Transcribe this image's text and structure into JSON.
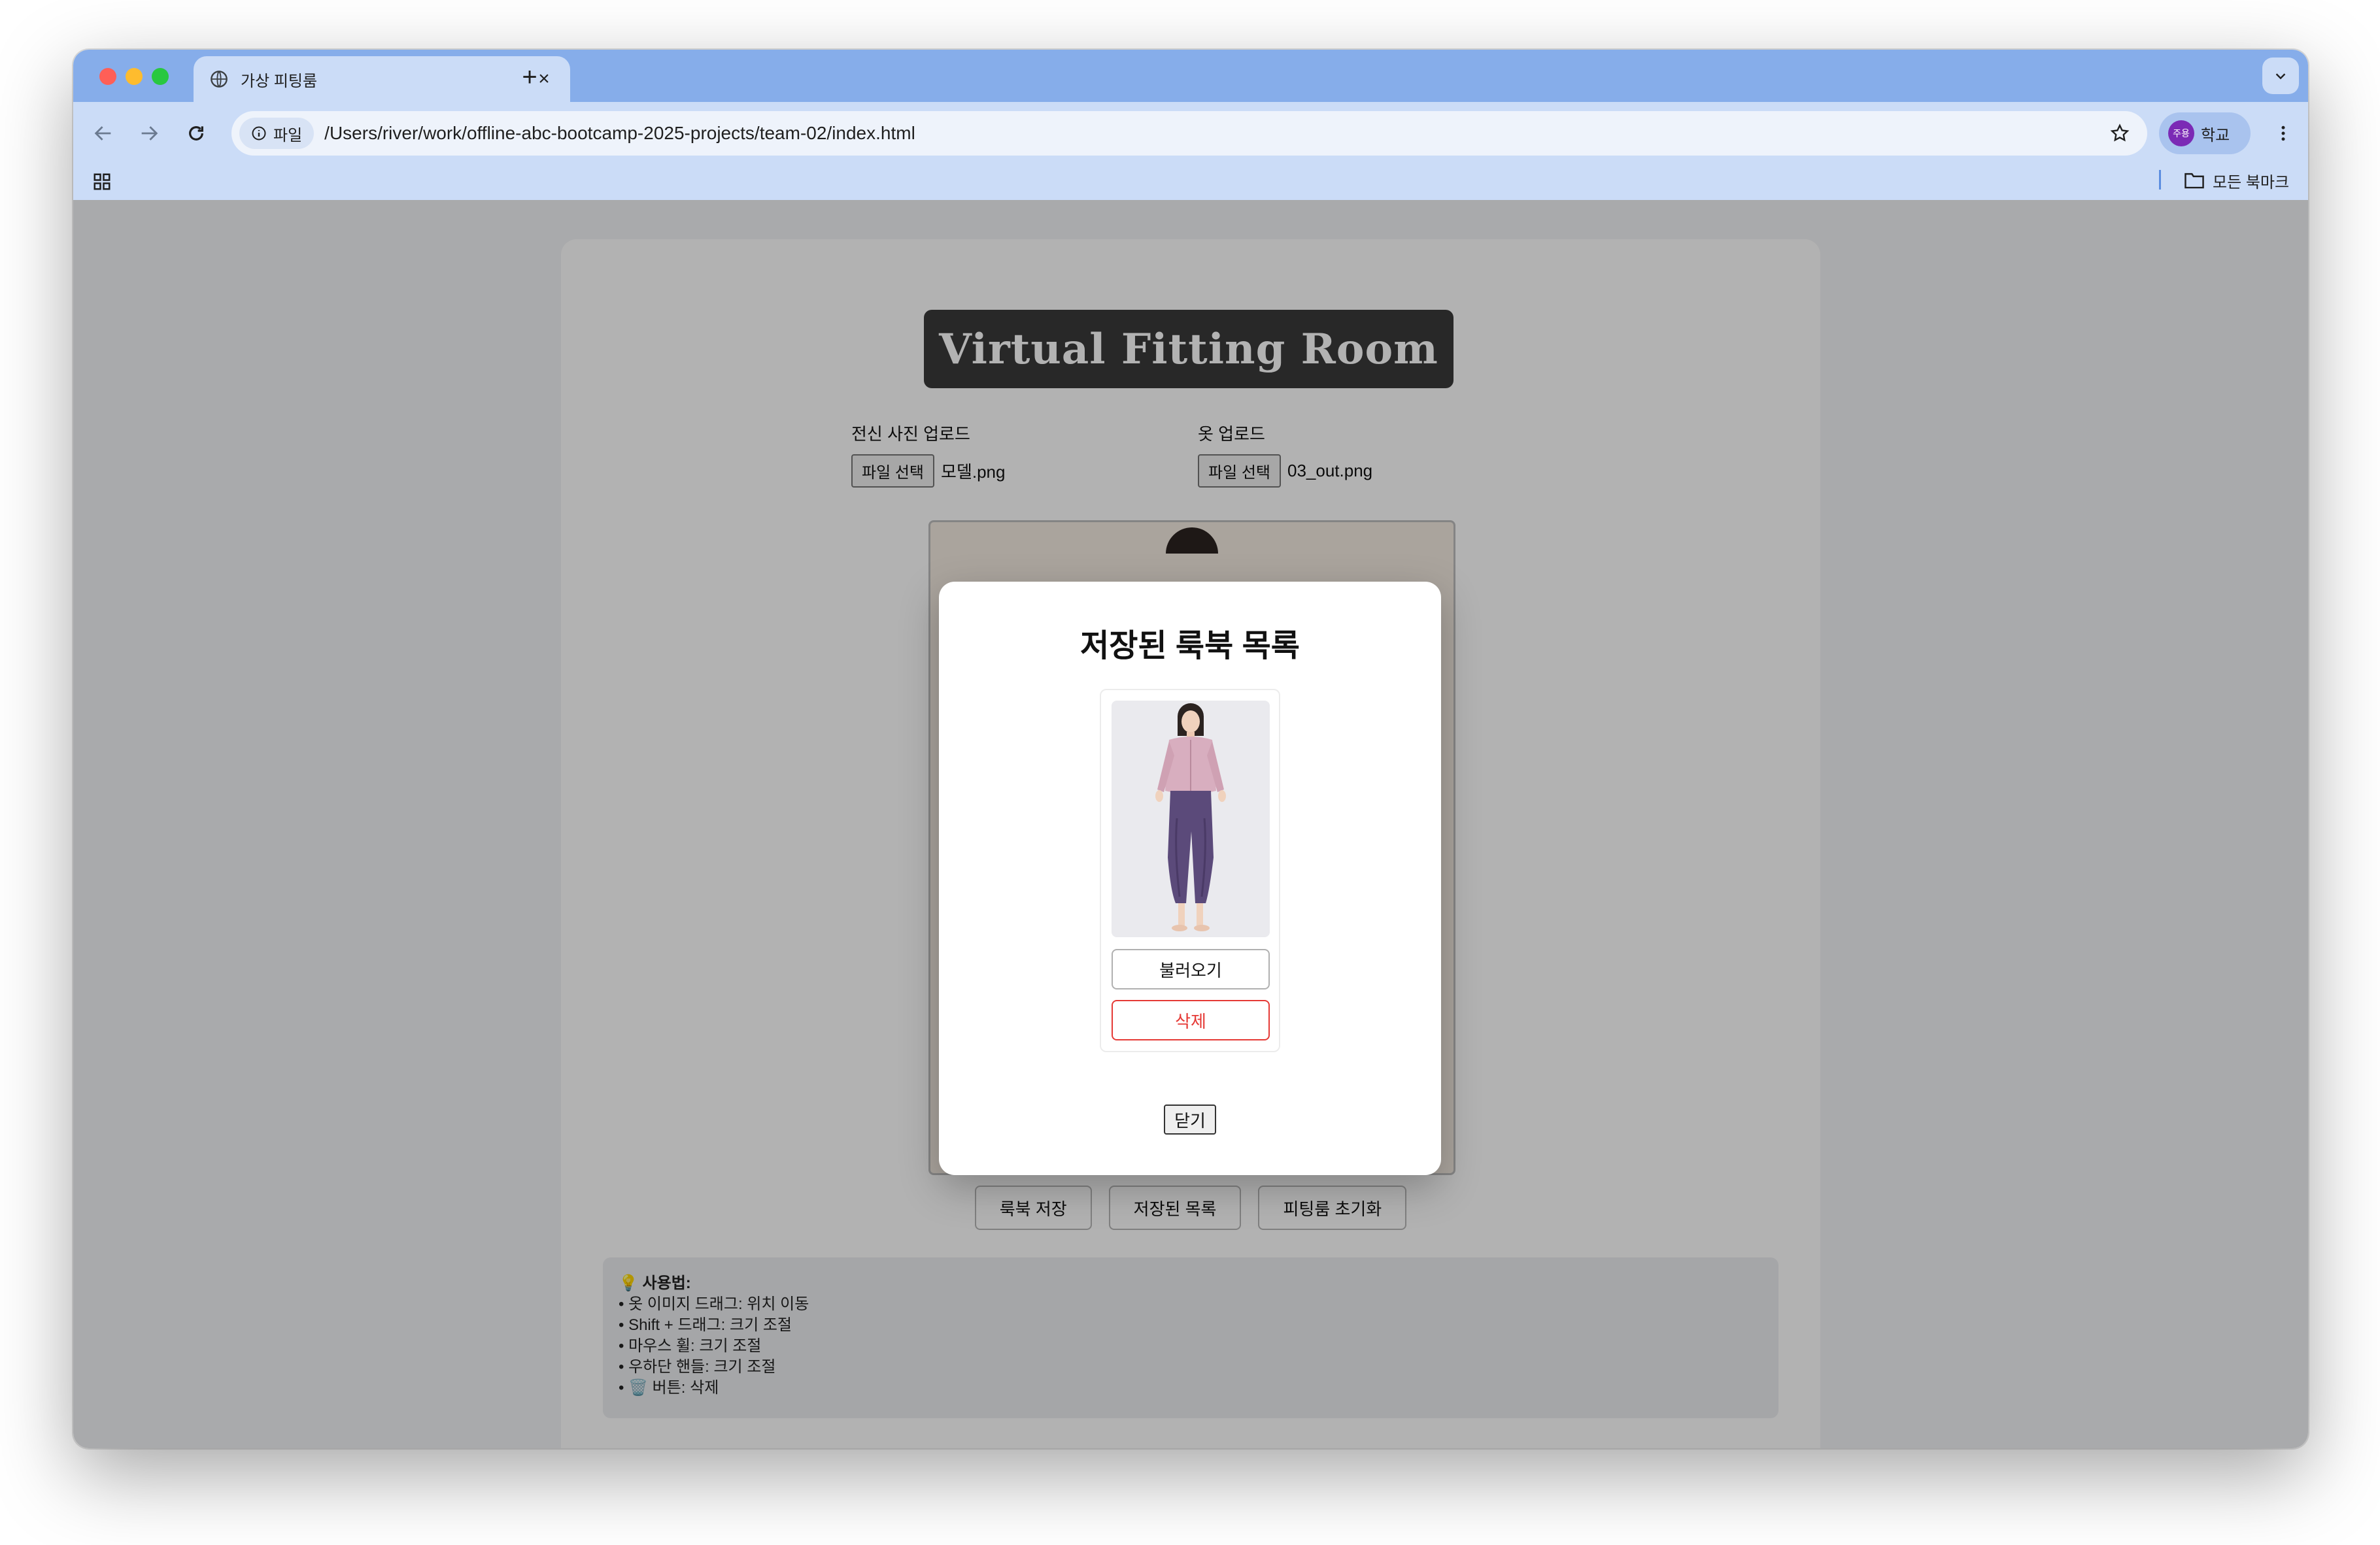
{
  "browser": {
    "tab_title": "가상 피팅룸",
    "url_chip": "파일",
    "url": "/Users/river/work/offline-abc-bootcamp-2025-projects/team-02/index.html",
    "profile_badge": "주용",
    "profile_name": "학교",
    "bookmarks_all": "모든 북마크"
  },
  "page": {
    "title": "Virtual Fitting Room",
    "upload_body": {
      "label": "전신 사진 업로드",
      "button": "파일 선택",
      "filename": "모델.png"
    },
    "upload_clothes": {
      "label": "옷 업로드",
      "button": "파일 선택",
      "filename": "03_out.png"
    },
    "actions": {
      "save": "룩북 저장",
      "saved_list": "저장된 목록",
      "reset": "피팅룸 초기화"
    },
    "howto": {
      "title": "💡 사용법:",
      "lines": [
        "• 옷 이미지 드래그: 위치 이동",
        "• Shift + 드래그: 크기 조절",
        "• 마우스 휠: 크기 조절",
        "• 우하단 핸들: 크기 조절",
        "• 🗑️ 버튼: 삭제"
      ]
    }
  },
  "modal": {
    "title": "저장된 룩북 목록",
    "looks": [
      {
        "load_label": "불러오기",
        "delete_label": "삭제"
      }
    ],
    "close_label": "닫기"
  },
  "colors": {
    "titlebar": "#86adea",
    "toolbar": "#cbdcf7",
    "title_bg": "#3a3a3a",
    "delete_red": "#e53935"
  }
}
